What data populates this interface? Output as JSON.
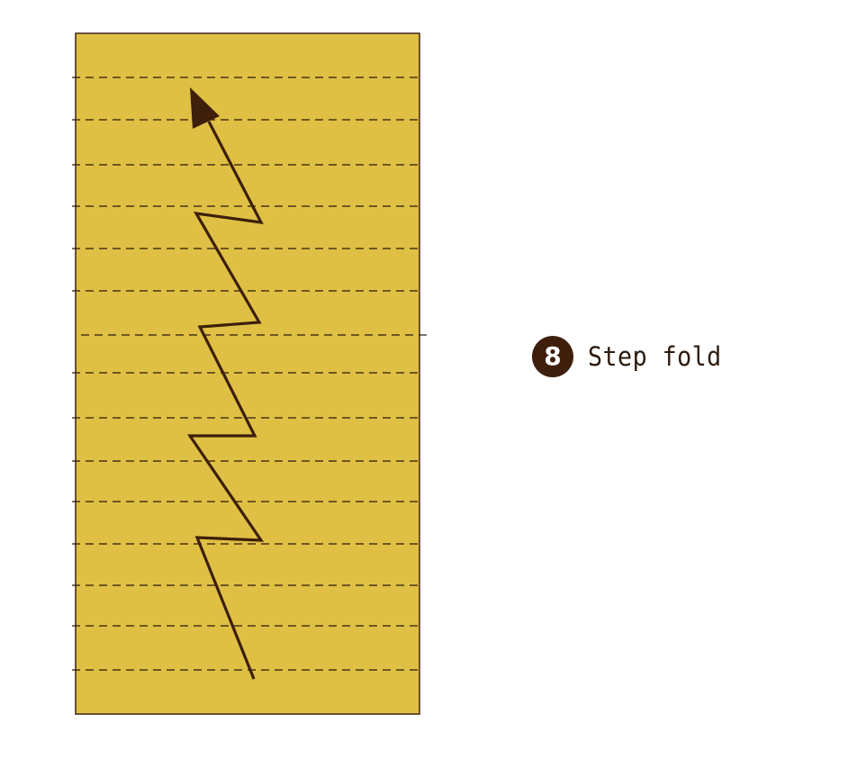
{
  "diagram": {
    "paper_color": "#e0c044",
    "border_color": "#3d2414",
    "arrow_color": "#3d1f0c",
    "fold_line_color": "#2b1a0c",
    "fold_line_count": 15,
    "fold_line_style": "dashed"
  },
  "step": {
    "number": "8",
    "label": "Step fold"
  }
}
